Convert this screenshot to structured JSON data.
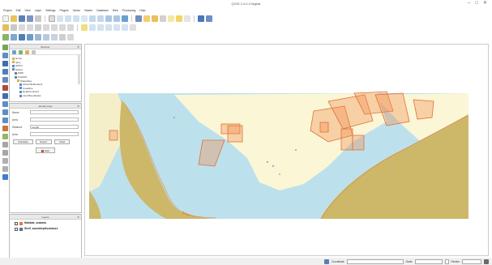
{
  "window": {
    "title": "QGIS 2.4.0-Chugiak",
    "controls": [
      "–",
      "□",
      "✕"
    ]
  },
  "menu": [
    "Project",
    "Edit",
    "View",
    "Layer",
    "Settings",
    "Plugins",
    "Vector",
    "Raster",
    "Database",
    "Web",
    "Processing",
    "Help"
  ],
  "panels": {
    "browser": {
      "title": "Browser",
      "tree": [
        {
          "label": "Home",
          "color": "#d9b24a"
        },
        {
          "label": "/proj",
          "color": "#d9b24a"
        },
        {
          "label": "GPKG",
          "color": "#5a8bc7"
        },
        {
          "label": "Hybrid",
          "color": "#5a8bc7"
        },
        {
          "label": "ESRI",
          "color": "#7c7c7c"
        },
        {
          "label": "PostGIS",
          "color": "#4d8fc7"
        },
        {
          "label": "Shapefiles",
          "color": "#d9b24a"
        },
        {
          "label": "ActiveTileRenders",
          "color": "#5a8bc7"
        },
        {
          "label": "Coastline",
          "color": "#5a8bc7"
        },
        {
          "label": "DepthContours",
          "color": "#5a8bc7"
        },
        {
          "label": "Land Boundaries",
          "color": "#5a8bc7"
        }
      ]
    },
    "identify": {
      "title": "Identify Area",
      "fields": [
        {
          "label": "Name",
          "value": ""
        },
        {
          "label": "Area",
          "value": ""
        },
        {
          "label": "Distance",
          "value": "Length"
        },
        {
          "label": "Area",
          "value": ""
        }
      ],
      "buttons": [
        "Calculate",
        "Export",
        "Clear"
      ],
      "help": "Help"
    },
    "layers": {
      "title": "Layers",
      "items": [
        {
          "label": "Habitats_seabeds",
          "color": "#e07a3a"
        },
        {
          "label": "Shelf_sounddepthcontours",
          "color": "#5a6fa8"
        }
      ]
    }
  },
  "status": {
    "coordinate_label": "Coordinate",
    "coordinate_value": "",
    "scale_label": "Scale",
    "scale_value": "",
    "render_label": "Render",
    "epsg_value": ""
  },
  "map": {
    "water_color": "#bde1ec",
    "land_color": "#cdb86a",
    "shallow_color": "#fbf6d6",
    "polygon_color": "#f08a4b"
  }
}
